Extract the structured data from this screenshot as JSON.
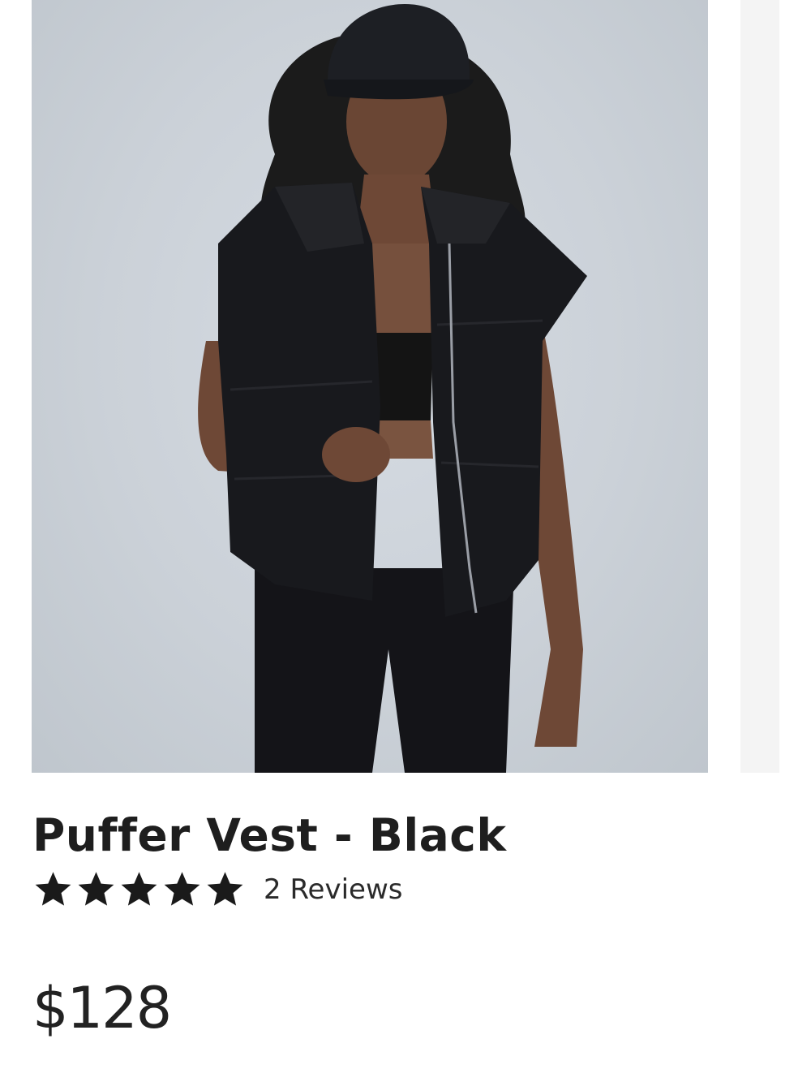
{
  "product": {
    "title": "Puffer Vest - Black",
    "rating": 5,
    "rating_max": 5,
    "reviews_label": "2 Reviews",
    "price": "$128"
  },
  "gallery": {
    "image_subject": "model-wearing-black-puffer-vest"
  },
  "icons": {
    "star": "star-icon"
  },
  "colors": {
    "text": "#1e1e1e",
    "star": "#1a1a1a",
    "image_background": "#cbd1d8",
    "next_slide": "#f4f4f4"
  }
}
